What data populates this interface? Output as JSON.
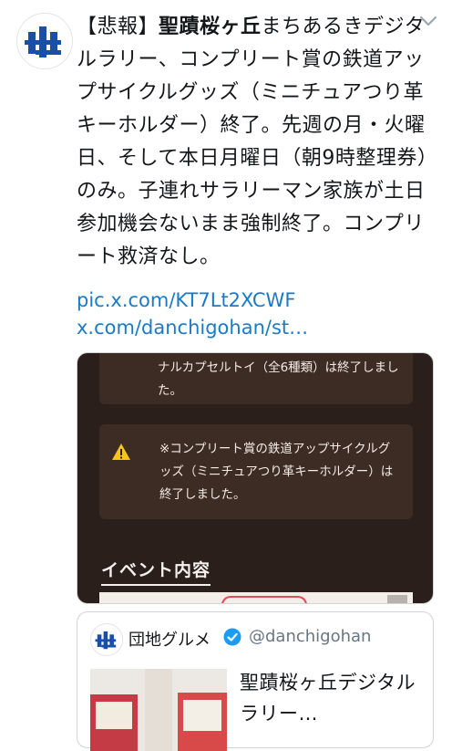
{
  "tweet": {
    "text_prefix": "【悲報】",
    "text_bold": "聖蹟桜ヶ丘",
    "text_body": "まちあるきデジタルラリー、コンプリート賞の鉄道アップサイクルグッズ（ミニチュアつり革キーホルダー）終了。先週の月・火曜日、そして本日月曜日（朝9時整理券）のみ。子連れサラリーマン家族が土日参加機会ないまま強制終了。コンプリート救済なし。",
    "link1": "pic.x.com/KT7Lt2XCWF",
    "link2": "x.com/danchigohan/st…"
  },
  "media": {
    "card1_text": "ナルカプセルトイ（全6種類）は終了しました。",
    "card2_text": "※コンプリート賞の鉄道アップサイクルグッズ（ミニチュアつり革キーホルダー）は終了しました。",
    "section_title": "イベント内容"
  },
  "quote": {
    "name": "団地グルメ",
    "handle": "@danchigohan",
    "text": "聖蹟桜ヶ丘デジタルラリー…"
  },
  "colors": {
    "link": "#1b7ac6",
    "verified": "#1d9bf0",
    "media_bg": "#2a1f1a",
    "card_bg": "#3d2c24",
    "warning": "#f5c518"
  },
  "icons": {
    "avatar": "keio-logo-avatar",
    "menu": "chevron-down-icon",
    "warning": "warning-icon",
    "verified": "verified-badge-icon"
  }
}
